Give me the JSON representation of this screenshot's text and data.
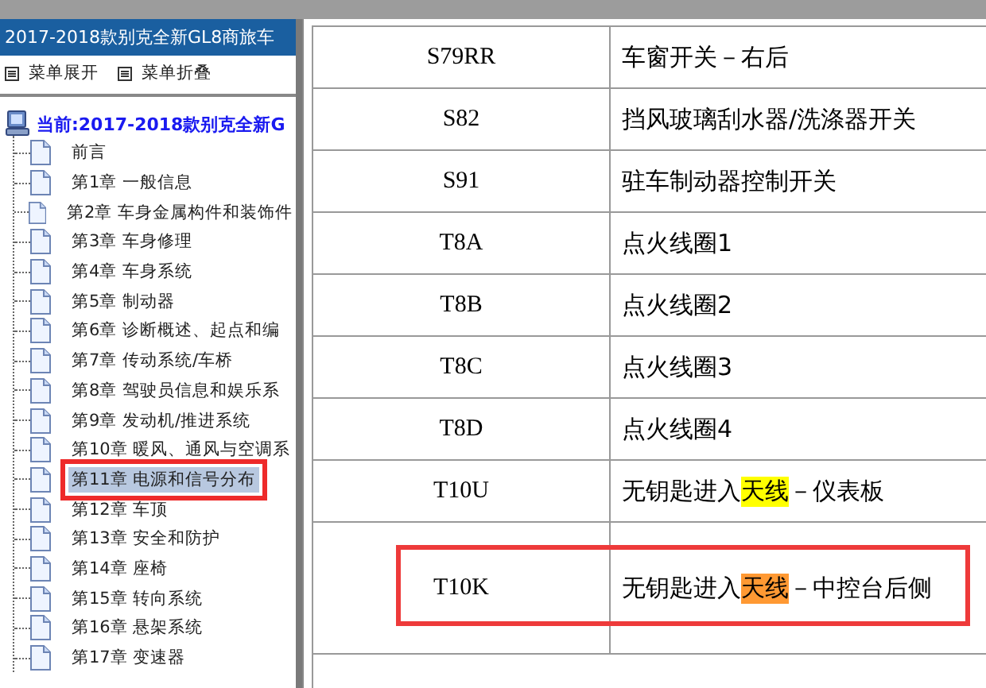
{
  "sidebar": {
    "title": "2017-2018款别克全新GL8商旅车",
    "menu": [
      {
        "label": "菜单展开"
      },
      {
        "label": "菜单折叠"
      }
    ],
    "root": {
      "label": "当前:2017-2018款别克全新G",
      "children": [
        {
          "label": "前言",
          "selected": false,
          "marked": false
        },
        {
          "label": "第1章 一般信息",
          "selected": false,
          "marked": false
        },
        {
          "label": "第2章 车身金属构件和装饰件",
          "selected": false,
          "marked": false
        },
        {
          "label": "第3章 车身修理",
          "selected": false,
          "marked": false
        },
        {
          "label": "第4章 车身系统",
          "selected": false,
          "marked": false
        },
        {
          "label": "第5章 制动器",
          "selected": false,
          "marked": false
        },
        {
          "label": "第6章 诊断概述、起点和编",
          "selected": false,
          "marked": false
        },
        {
          "label": "第7章 传动系统/车桥",
          "selected": false,
          "marked": false
        },
        {
          "label": "第8章 驾驶员信息和娱乐系",
          "selected": false,
          "marked": false
        },
        {
          "label": "第9章 发动机/推进系统",
          "selected": false,
          "marked": false
        },
        {
          "label": "第10章 暖风、通风与空调系",
          "selected": false,
          "marked": false
        },
        {
          "label": "第11章 电源和信号分布",
          "selected": true,
          "marked": true
        },
        {
          "label": "第12章 车顶",
          "selected": false,
          "marked": false
        },
        {
          "label": "第13章 安全和防护",
          "selected": false,
          "marked": false
        },
        {
          "label": "第14章 座椅",
          "selected": false,
          "marked": false
        },
        {
          "label": "第15章 转向系统",
          "selected": false,
          "marked": false
        },
        {
          "label": "第16章 悬架系统",
          "selected": false,
          "marked": false
        },
        {
          "label": "第17章 变速器",
          "selected": false,
          "marked": false
        }
      ]
    }
  },
  "table": {
    "rows": [
      {
        "code": "S79RR",
        "description": [
          {
            "text": "车窗开关－右后"
          }
        ],
        "marked": false
      },
      {
        "code": "S82",
        "description": [
          {
            "text": "挡风玻璃刮水器/洗涤器开关"
          }
        ],
        "marked": false
      },
      {
        "code": "S91",
        "description": [
          {
            "text": "驻车制动器控制开关"
          }
        ],
        "marked": false
      },
      {
        "code": "T8A",
        "description": [
          {
            "text": "点火线圈1"
          }
        ],
        "marked": false
      },
      {
        "code": "T8B",
        "description": [
          {
            "text": "点火线圈2"
          }
        ],
        "marked": false
      },
      {
        "code": "T8C",
        "description": [
          {
            "text": "点火线圈3"
          }
        ],
        "marked": false
      },
      {
        "code": "T8D",
        "description": [
          {
            "text": "点火线圈4"
          }
        ],
        "marked": false
      },
      {
        "code": "T10U",
        "description": [
          {
            "text": "无钥匙进入"
          },
          {
            "text": "天线",
            "color": "#ffff00"
          },
          {
            "text": "－仪表板"
          }
        ],
        "marked": false
      },
      {
        "code": "T10K",
        "description": [
          {
            "text": "无钥匙进入"
          },
          {
            "text": "天线",
            "color": "#ff9933"
          },
          {
            "text": "－中控台后侧"
          }
        ],
        "marked": true
      }
    ]
  }
}
